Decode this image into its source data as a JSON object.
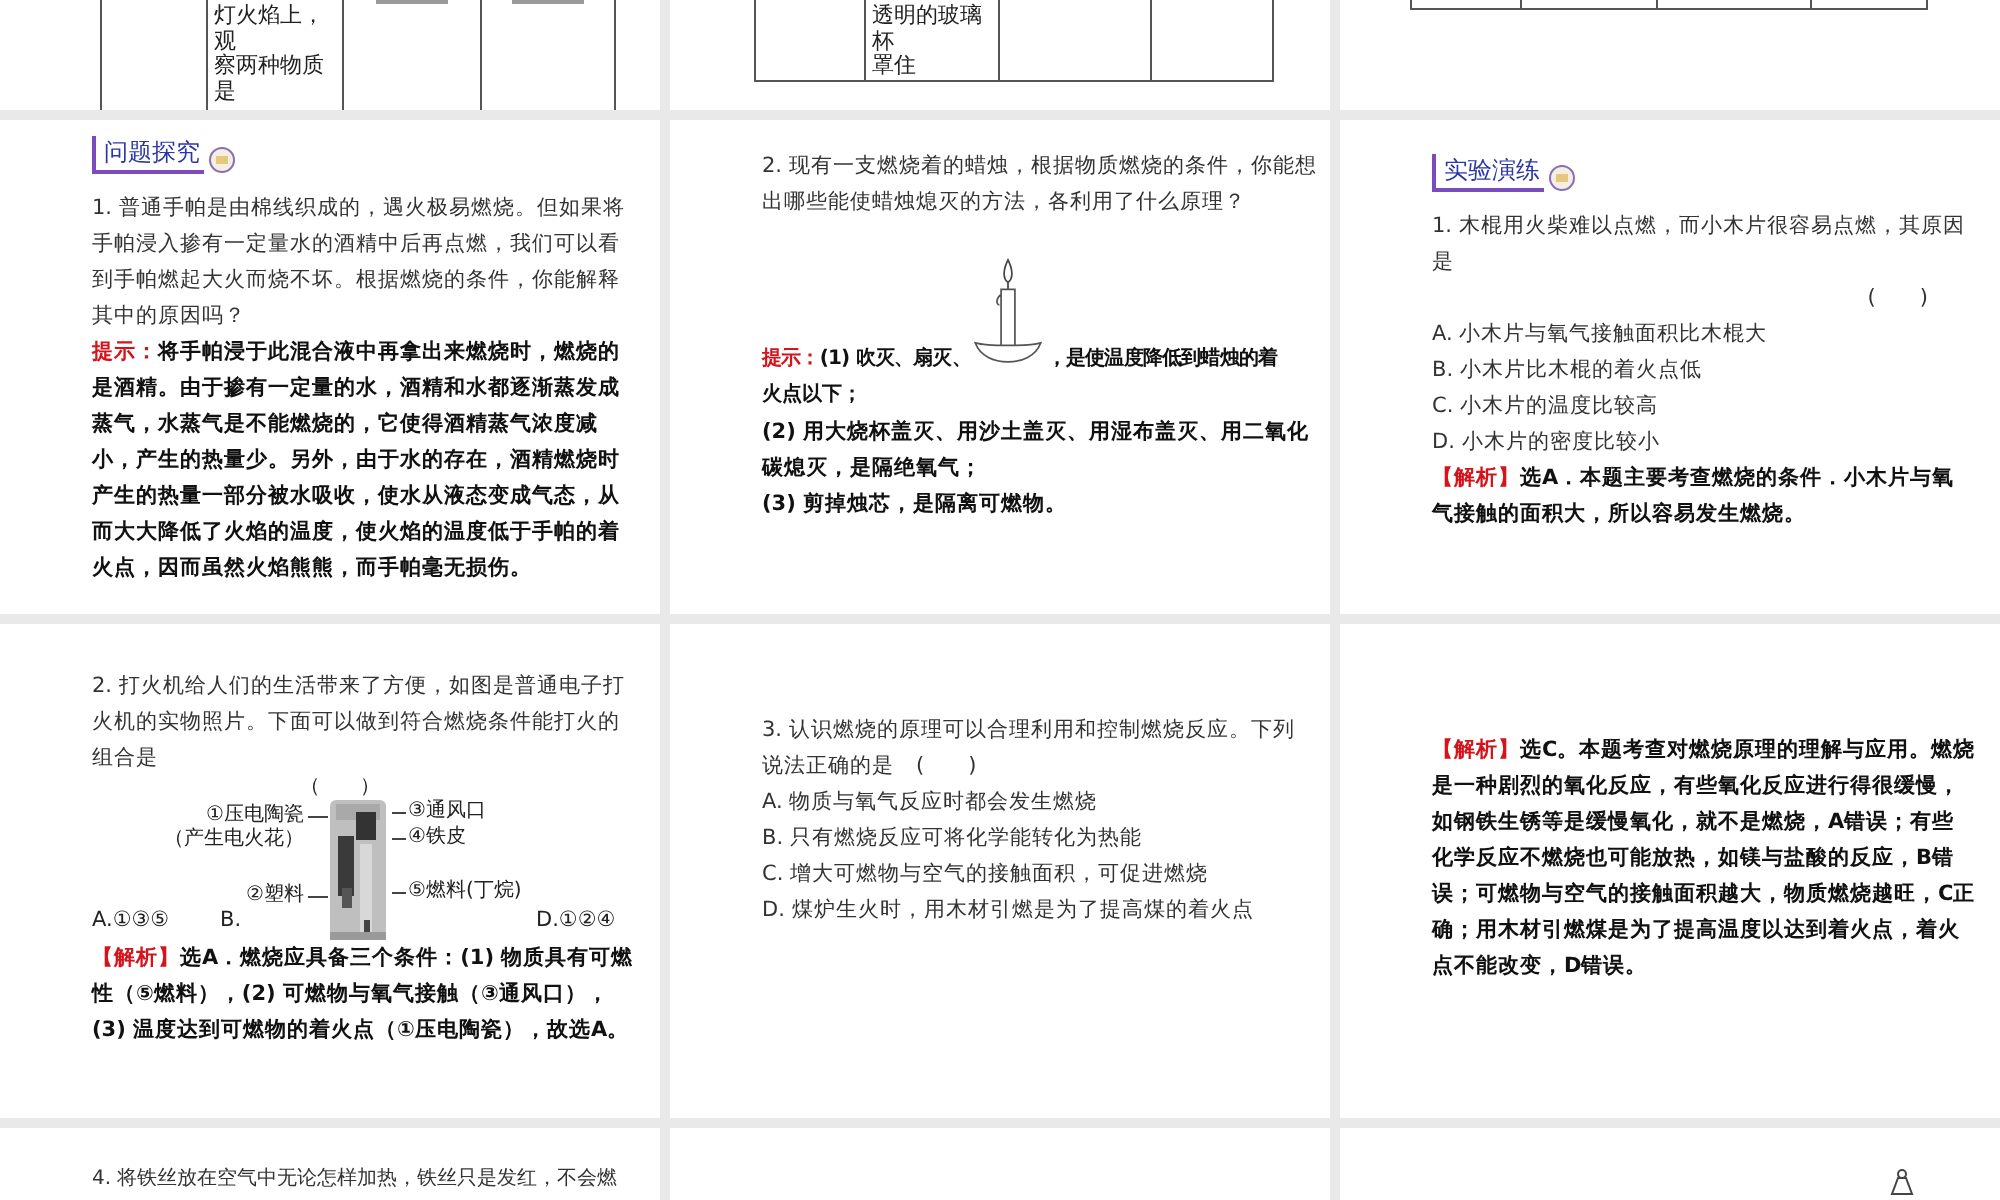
{
  "top_row": [
    {
      "kind": "table",
      "cell_lines": [
        "灯火焰上，",
        "观",
        "察两种物质",
        "是"
      ]
    },
    {
      "kind": "table",
      "cell_lines": [
        "透明的玻璃",
        "杯",
        "罩住"
      ]
    },
    {
      "kind": "table_end"
    }
  ],
  "slides": [
    {
      "blocks": [
        {
          "kind": "heading",
          "text": "问题探究"
        },
        {
          "kind": "para",
          "text": "1. 普通手帕是由棉线织成的，遇火极易燃烧。但如果将手帕浸入掺有一定量水的酒精中后再点燃，我们可以看到手帕燃起大火而烧不坏。根据燃烧的条件，你能解释其中的原因吗？"
        },
        {
          "kind": "hint",
          "label": "提示：",
          "text": "将手帕浸于此混合液中再拿出来燃烧时，燃烧的是酒精。由于掺有一定量的水，酒精和水都逐渐蒸发成蒸气，水蒸气是不能燃烧的，它使得酒精蒸气浓度减小，产生的热量少。另外，由于水的存在，酒精燃烧时产生的热量一部分被水吸收，使水从液态变成气态，从而大大降低了火焰的温度，使火焰的温度低于手帕的着火点，因而虽然火焰熊熊，而手帕毫无损伤。"
        }
      ]
    },
    {
      "blocks": [
        {
          "kind": "para",
          "text": "2. 现有一支燃烧着的蜡烛，根据物质燃烧的条件，你能想出哪些能使蜡烛熄灭的方法，各利用了什么原理？"
        },
        {
          "kind": "hint_figure",
          "label": "提示：",
          "before": "(1) 吹灭、扇灭、",
          "after": "，是使温度降低到蜡烛的着",
          "next_line": "火点以下；"
        },
        {
          "kind": "bold",
          "text": "(2) 用大烧杯盖灭、用沙土盖灭、用湿布盖灭、用二氧化碳熄灭，是隔绝氧气；"
        },
        {
          "kind": "bold",
          "text": "(3) 剪掉烛芯，是隔离可燃物。"
        }
      ]
    },
    {
      "blocks": [
        {
          "kind": "heading",
          "text": "实验演练"
        },
        {
          "kind": "para",
          "text": "1. 木棍用火柴难以点燃，而小木片很容易点燃，其原因是"
        },
        {
          "kind": "blank",
          "text": "(　　)"
        },
        {
          "kind": "option",
          "text": "A. 小木片与氧气接触面积比木棍大"
        },
        {
          "kind": "option",
          "text": "B. 小木片比木棍的着火点低"
        },
        {
          "kind": "option",
          "text": "C. 小木片的温度比较高"
        },
        {
          "kind": "option",
          "text": "D. 小木片的密度比较小"
        },
        {
          "kind": "answer",
          "label": "【解析】",
          "text": "选A．本题主要考查燃烧的条件．小木片与氧气接触的面积大，所以容易发生燃烧。"
        }
      ]
    },
    {
      "blocks": [
        {
          "kind": "para",
          "text": "2. 打火机给人们的生活带来了方便，如图是普通电子打火机的实物照片。下面可以做到符合燃烧条件能打火的组合是"
        },
        {
          "kind": "lighter_figure",
          "paren": "（　　）",
          "options": [
            "A.①③⑤",
            "B.",
            "D.①②④"
          ],
          "callouts": [
            "①压电陶瓷",
            "（产生电火花）",
            "③通风口",
            "④铁皮",
            "②塑料",
            "⑤燃料(丁烷)"
          ]
        },
        {
          "kind": "answer",
          "label": "【解析】",
          "text": "选A．燃烧应具备三个条件：(1) 物质具有可燃性（⑤燃料），(2) 可燃物与氧气接触（③通风口），(3) 温度达到可燃物的着火点（①压电陶瓷），故选A。"
        }
      ]
    },
    {
      "blocks": [
        {
          "kind": "para",
          "text": "3. 认识燃烧的原理可以合理利用和控制燃烧反应。下列说法正确的是　(　　)"
        },
        {
          "kind": "option",
          "text": "A. 物质与氧气反应时都会发生燃烧"
        },
        {
          "kind": "option",
          "text": "B. 只有燃烧反应可将化学能转化为热能"
        },
        {
          "kind": "option",
          "text": "C. 增大可燃物与空气的接触面积，可促进燃烧"
        },
        {
          "kind": "option",
          "text": "D. 煤炉生火时，用木材引燃是为了提高煤的着火点"
        }
      ]
    },
    {
      "blocks": [
        {
          "kind": "answer",
          "label": "【解析】",
          "text": "选C。本题考查对燃烧原理的理解与应用。燃烧是一种剧烈的氧化反应，有些氧化反应进行得很缓慢，如钢铁生锈等是缓慢氧化，就不是燃烧，A错误；有些化学反应不燃烧也可能放热，如镁与盐酸的反应，B错误；可燃物与空气的接触面积越大，物质燃烧越旺，C正确；用木材引燃煤是为了提高温度以达到着火点，着火点不能改变，D错误。"
        }
      ]
    },
    {
      "blocks": [
        {
          "kind": "para",
          "text": "4. 将铁丝放在空气中无论怎样加热，铁丝只是发红，不会燃"
        }
      ]
    },
    {
      "blocks": [
        {
          "kind": "icon"
        }
      ]
    }
  ]
}
